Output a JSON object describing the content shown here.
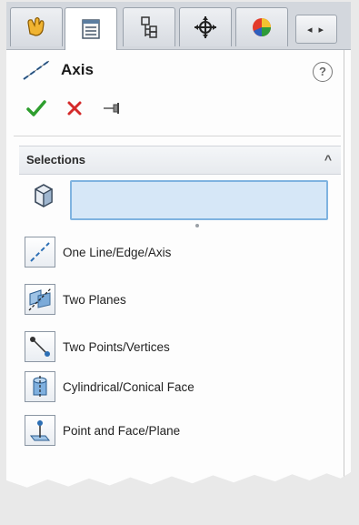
{
  "tabs": [
    {
      "icon": "feature-manager-icon"
    },
    {
      "icon": "property-manager-icon"
    },
    {
      "icon": "configuration-manager-icon"
    },
    {
      "icon": "dimxpert-manager-icon"
    },
    {
      "icon": "display-manager-icon"
    }
  ],
  "tab_scroll_label": "◂ ▸",
  "header": {
    "title": "Axis",
    "title_icon": "axis-icon",
    "help_label": "?"
  },
  "actions": {
    "ok_icon": "check-icon",
    "cancel_icon": "close-icon",
    "pin_icon": "pushpin-icon"
  },
  "selections": {
    "label": "Selections",
    "collapse_label": "^",
    "box_value": ""
  },
  "options": [
    {
      "label": "One Line/Edge/Axis",
      "icon": "line-edge-axis-icon"
    },
    {
      "label": "Two Planes",
      "icon": "two-planes-icon"
    },
    {
      "label": "Two Points/Vertices",
      "icon": "two-points-icon"
    },
    {
      "label": "Cylindrical/Conical Face",
      "icon": "cylindrical-face-icon"
    },
    {
      "label": "Point and Face/Plane",
      "icon": "point-face-icon"
    }
  ],
  "colors": {
    "accent_blue": "#d6e7f7",
    "ok_green": "#2e9e2e",
    "cancel_red": "#d42a2a"
  }
}
